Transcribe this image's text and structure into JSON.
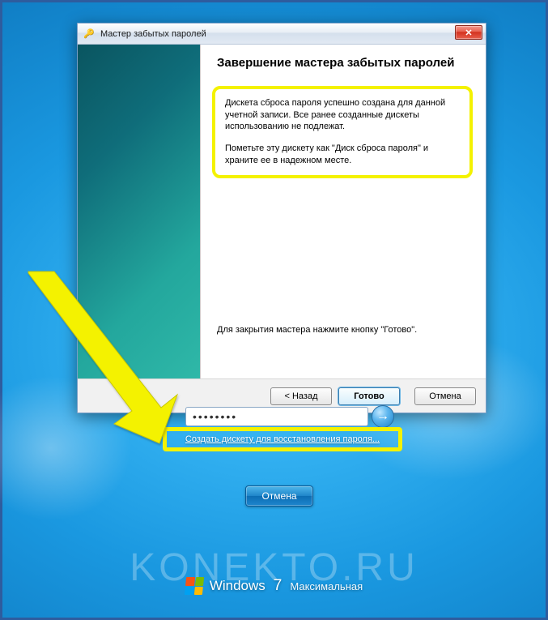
{
  "wizard": {
    "title": "Мастер забытых паролей",
    "heading": "Завершение мастера забытых паролей",
    "para1": "Дискета сброса пароля успешно создана для данной учетной записи. Все ранее созданные дискеты использованию не подлежат.",
    "para2": "Пометьте эту дискету как \"Диск сброса пароля\" и храните ее в надежном месте.",
    "close_hint": "Для закрытия мастера нажмите кнопку \"Готово\".",
    "buttons": {
      "back": "< Назад",
      "finish": "Готово",
      "cancel": "Отмена"
    }
  },
  "login": {
    "password_value": "••••••••",
    "create_disk_link": "Создать дискету для восстановления пароля...",
    "cancel": "Отмена"
  },
  "branding": {
    "product": "Windows",
    "version": "7",
    "edition": "Максимальная"
  },
  "watermark": "KONEKTO.RU",
  "icons": {
    "key": "🔑",
    "close": "✕",
    "arrow": "→"
  }
}
